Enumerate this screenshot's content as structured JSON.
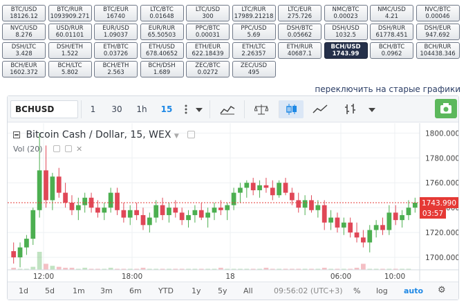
{
  "pairs": [
    {
      "pair": "BTC/USD",
      "price": "18126.12"
    },
    {
      "pair": "BTC/RUR",
      "price": "1093909.271"
    },
    {
      "pair": "BTC/EUR",
      "price": "16740"
    },
    {
      "pair": "LTC/BTC",
      "price": "0.01648"
    },
    {
      "pair": "LTC/USD",
      "price": "300"
    },
    {
      "pair": "LTC/RUR",
      "price": "17989.21218"
    },
    {
      "pair": "LTC/EUR",
      "price": "275.726"
    },
    {
      "pair": "NMC/BTC",
      "price": "0.00023"
    },
    {
      "pair": "NMC/USD",
      "price": "4.21"
    },
    {
      "pair": "NVC/BTC",
      "price": "0.00046"
    },
    {
      "pair": "NVC/USD",
      "price": "8.276"
    },
    {
      "pair": "USD/RUR",
      "price": "60.01101"
    },
    {
      "pair": "EUR/USD",
      "price": "1.09037"
    },
    {
      "pair": "EUR/RUR",
      "price": "65.50503"
    },
    {
      "pair": "PPC/BTC",
      "price": "0.00031"
    },
    {
      "pair": "PPC/USD",
      "price": "5.69"
    },
    {
      "pair": "DSH/BTC",
      "price": "0.05662"
    },
    {
      "pair": "DSH/USD",
      "price": "1032.5"
    },
    {
      "pair": "DSH/RUR",
      "price": "61778.451"
    },
    {
      "pair": "DSH/EUR",
      "price": "947.692"
    },
    {
      "pair": "DSH/LTC",
      "price": "3.428"
    },
    {
      "pair": "DSH/ETH",
      "price": "1.522"
    },
    {
      "pair": "ETH/BTC",
      "price": "0.03726"
    },
    {
      "pair": "ETH/USD",
      "price": "678.40652"
    },
    {
      "pair": "ETH/EUR",
      "price": "622.18439"
    },
    {
      "pair": "ETH/LTC",
      "price": "2.26357"
    },
    {
      "pair": "ETH/RUR",
      "price": "40687.1"
    },
    {
      "pair": "BCH/USD",
      "price": "1743.99",
      "active": true
    },
    {
      "pair": "BCH/BTC",
      "price": "0.0962"
    },
    {
      "pair": "BCH/RUR",
      "price": "104438.346"
    },
    {
      "pair": "BCH/EUR",
      "price": "1602.372"
    },
    {
      "pair": "BCH/LTC",
      "price": "5.802"
    },
    {
      "pair": "BCH/ETH",
      "price": "2.563"
    },
    {
      "pair": "BCH/DSH",
      "price": "1.689"
    },
    {
      "pair": "ZEC/BTC",
      "price": "0.0272"
    },
    {
      "pair": "ZEC/USD",
      "price": "495"
    }
  ],
  "switch_link": "переключить на старые графики",
  "toolbar": {
    "symbol": "BCHUSD",
    "intervals": [
      "1",
      "30",
      "1h",
      "15"
    ],
    "active_interval": "15",
    "icons": [
      "more-vert-icon",
      "dropdown-icon",
      "indicators-icon",
      "compare-icon",
      "candles-icon",
      "line-icon",
      "bars-icon",
      "dropdown-icon",
      "camera-icon"
    ]
  },
  "legend": {
    "title": "Bitcoin Cash / Dollar, 15, WEX",
    "vol_label": "Vol (20)"
  },
  "price_axis": {
    "ticks": [
      "1800.000",
      "1780.000",
      "1760.000",
      "1740.000",
      "1720.000",
      "1700.000"
    ],
    "last_price": "1743.990",
    "countdown": "03:57",
    "last_price_color": "#e53935"
  },
  "time_axis": {
    "ticks": [
      "12:00",
      "18:00",
      "18",
      "06:00",
      "10:00"
    ]
  },
  "bottom_bar": {
    "ranges": [
      "1d",
      "5d",
      "1m",
      "3m",
      "6m",
      "YTD",
      "1y",
      "5y",
      "All"
    ],
    "clock": "09:56:02 (UTC+3)",
    "percent": "%",
    "log": "log",
    "auto": "auto"
  },
  "colors": {
    "up": "#4caf50",
    "down": "#e04757",
    "accent": "#1e88e5"
  },
  "chart_data": {
    "type": "candlestick",
    "title": "Bitcoin Cash / Dollar, 15, WEX",
    "ylim": [
      1690,
      1808
    ],
    "y_ticks": [
      1700,
      1720,
      1740,
      1760,
      1780,
      1800
    ],
    "candles": [
      {
        "o": 1705,
        "h": 1712,
        "l": 1695,
        "c": 1700
      },
      {
        "o": 1700,
        "h": 1712,
        "l": 1692,
        "c": 1708
      },
      {
        "o": 1708,
        "h": 1718,
        "l": 1702,
        "c": 1715
      },
      {
        "o": 1715,
        "h": 1740,
        "l": 1710,
        "c": 1738
      },
      {
        "o": 1738,
        "h": 1800,
        "l": 1732,
        "c": 1770
      },
      {
        "o": 1770,
        "h": 1790,
        "l": 1740,
        "c": 1746
      },
      {
        "o": 1746,
        "h": 1768,
        "l": 1738,
        "c": 1765
      },
      {
        "o": 1765,
        "h": 1772,
        "l": 1748,
        "c": 1752
      },
      {
        "o": 1752,
        "h": 1760,
        "l": 1740,
        "c": 1744
      },
      {
        "o": 1744,
        "h": 1750,
        "l": 1734,
        "c": 1738
      },
      {
        "o": 1738,
        "h": 1748,
        "l": 1730,
        "c": 1742
      },
      {
        "o": 1742,
        "h": 1752,
        "l": 1736,
        "c": 1748
      },
      {
        "o": 1748,
        "h": 1752,
        "l": 1736,
        "c": 1740
      },
      {
        "o": 1740,
        "h": 1746,
        "l": 1732,
        "c": 1736
      },
      {
        "o": 1736,
        "h": 1744,
        "l": 1730,
        "c": 1740
      },
      {
        "o": 1740,
        "h": 1756,
        "l": 1736,
        "c": 1752
      },
      {
        "o": 1752,
        "h": 1756,
        "l": 1734,
        "c": 1738
      },
      {
        "o": 1738,
        "h": 1744,
        "l": 1728,
        "c": 1732
      },
      {
        "o": 1732,
        "h": 1742,
        "l": 1726,
        "c": 1738
      },
      {
        "o": 1738,
        "h": 1744,
        "l": 1730,
        "c": 1734
      },
      {
        "o": 1734,
        "h": 1740,
        "l": 1722,
        "c": 1726
      },
      {
        "o": 1726,
        "h": 1736,
        "l": 1720,
        "c": 1732
      },
      {
        "o": 1732,
        "h": 1746,
        "l": 1728,
        "c": 1742
      },
      {
        "o": 1742,
        "h": 1748,
        "l": 1730,
        "c": 1734
      },
      {
        "o": 1734,
        "h": 1744,
        "l": 1728,
        "c": 1740
      },
      {
        "o": 1740,
        "h": 1746,
        "l": 1732,
        "c": 1736
      },
      {
        "o": 1736,
        "h": 1740,
        "l": 1726,
        "c": 1730
      },
      {
        "o": 1730,
        "h": 1738,
        "l": 1724,
        "c": 1734
      },
      {
        "o": 1734,
        "h": 1742,
        "l": 1728,
        "c": 1738
      },
      {
        "o": 1738,
        "h": 1744,
        "l": 1730,
        "c": 1732
      },
      {
        "o": 1732,
        "h": 1740,
        "l": 1724,
        "c": 1736
      },
      {
        "o": 1736,
        "h": 1744,
        "l": 1730,
        "c": 1740
      },
      {
        "o": 1740,
        "h": 1746,
        "l": 1734,
        "c": 1738
      },
      {
        "o": 1738,
        "h": 1744,
        "l": 1730,
        "c": 1742
      },
      {
        "o": 1742,
        "h": 1756,
        "l": 1738,
        "c": 1752
      },
      {
        "o": 1752,
        "h": 1760,
        "l": 1744,
        "c": 1756
      },
      {
        "o": 1756,
        "h": 1762,
        "l": 1748,
        "c": 1760
      },
      {
        "o": 1760,
        "h": 1764,
        "l": 1750,
        "c": 1754
      },
      {
        "o": 1754,
        "h": 1762,
        "l": 1748,
        "c": 1758
      },
      {
        "o": 1758,
        "h": 1764,
        "l": 1752,
        "c": 1756
      },
      {
        "o": 1756,
        "h": 1762,
        "l": 1746,
        "c": 1750
      },
      {
        "o": 1750,
        "h": 1762,
        "l": 1748,
        "c": 1760
      },
      {
        "o": 1760,
        "h": 1764,
        "l": 1750,
        "c": 1752
      },
      {
        "o": 1752,
        "h": 1756,
        "l": 1742,
        "c": 1746
      },
      {
        "o": 1746,
        "h": 1752,
        "l": 1736,
        "c": 1740
      },
      {
        "o": 1740,
        "h": 1750,
        "l": 1734,
        "c": 1746
      },
      {
        "o": 1746,
        "h": 1750,
        "l": 1736,
        "c": 1738
      },
      {
        "o": 1738,
        "h": 1746,
        "l": 1732,
        "c": 1742
      },
      {
        "o": 1742,
        "h": 1746,
        "l": 1722,
        "c": 1728
      },
      {
        "o": 1728,
        "h": 1738,
        "l": 1722,
        "c": 1732
      },
      {
        "o": 1732,
        "h": 1736,
        "l": 1720,
        "c": 1724
      },
      {
        "o": 1724,
        "h": 1732,
        "l": 1718,
        "c": 1728
      },
      {
        "o": 1728,
        "h": 1732,
        "l": 1716,
        "c": 1720
      },
      {
        "o": 1720,
        "h": 1728,
        "l": 1712,
        "c": 1716
      },
      {
        "o": 1716,
        "h": 1722,
        "l": 1708,
        "c": 1712
      },
      {
        "o": 1712,
        "h": 1726,
        "l": 1704,
        "c": 1722
      },
      {
        "o": 1722,
        "h": 1730,
        "l": 1716,
        "c": 1726
      },
      {
        "o": 1726,
        "h": 1732,
        "l": 1718,
        "c": 1722
      },
      {
        "o": 1722,
        "h": 1742,
        "l": 1718,
        "c": 1736
      },
      {
        "o": 1736,
        "h": 1742,
        "l": 1726,
        "c": 1730
      },
      {
        "o": 1730,
        "h": 1738,
        "l": 1724,
        "c": 1734
      },
      {
        "o": 1734,
        "h": 1746,
        "l": 1730,
        "c": 1740
      },
      {
        "o": 1740,
        "h": 1748,
        "l": 1736,
        "c": 1744
      }
    ],
    "volume": [
      2,
      1,
      1,
      3,
      18,
      6,
      4,
      3,
      2,
      2,
      1,
      2,
      1,
      1,
      1,
      2,
      1,
      1,
      1,
      1,
      2,
      1,
      1,
      1,
      1,
      1,
      1,
      1,
      1,
      1,
      1,
      1,
      2,
      1,
      1,
      1,
      1,
      1,
      1,
      2,
      1,
      1,
      1,
      1,
      1,
      1,
      1,
      1,
      2,
      1,
      1,
      1,
      1,
      2,
      6,
      1,
      1,
      1,
      1,
      1,
      1,
      1
    ]
  }
}
